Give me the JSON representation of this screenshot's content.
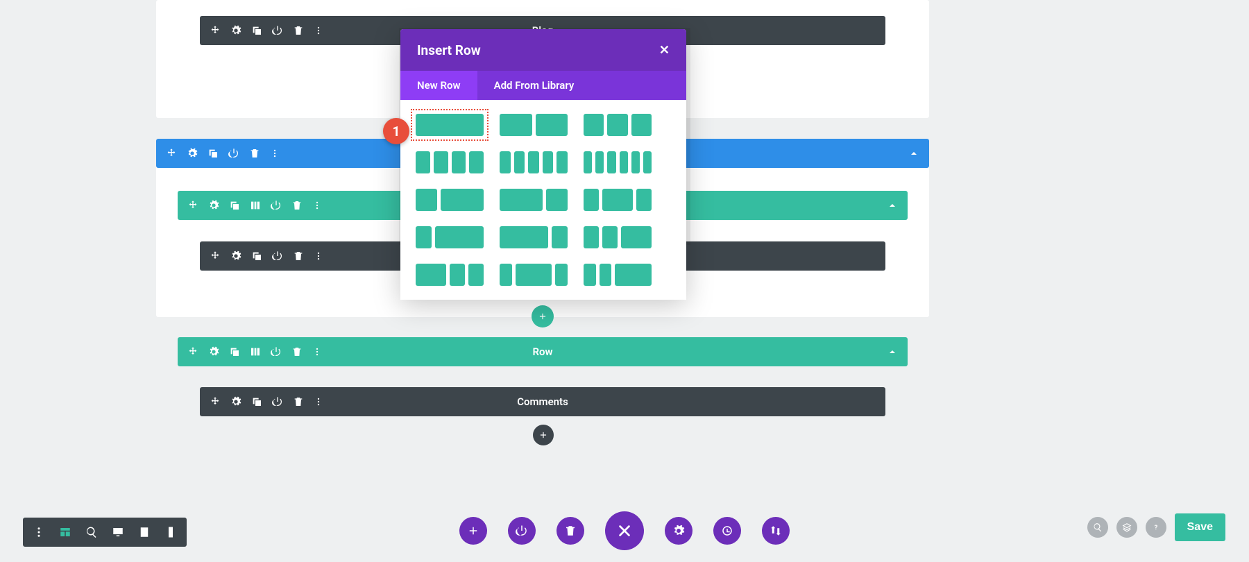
{
  "modules": {
    "blog": "Blog",
    "comments": "Comments"
  },
  "rows": {
    "row": "Row"
  },
  "modal": {
    "title": "Insert Row",
    "tab_new": "New Row",
    "tab_library": "Add From Library"
  },
  "annotation": {
    "badge": "1"
  },
  "save": {
    "label": "Save"
  },
  "layouts": [
    [
      1
    ],
    [
      1,
      1
    ],
    [
      1,
      1,
      1
    ],
    [
      1,
      1,
      1,
      1
    ],
    [
      1,
      1,
      1,
      1,
      1
    ],
    [
      1,
      1,
      1,
      1,
      1,
      1
    ],
    [
      1,
      2
    ],
    [
      2,
      1
    ],
    [
      1,
      2,
      1
    ],
    [
      1,
      3
    ],
    [
      3,
      1
    ],
    [
      1,
      1,
      2
    ],
    [
      2,
      1,
      1
    ],
    [
      1,
      3,
      1
    ],
    [
      1,
      1,
      3
    ]
  ]
}
